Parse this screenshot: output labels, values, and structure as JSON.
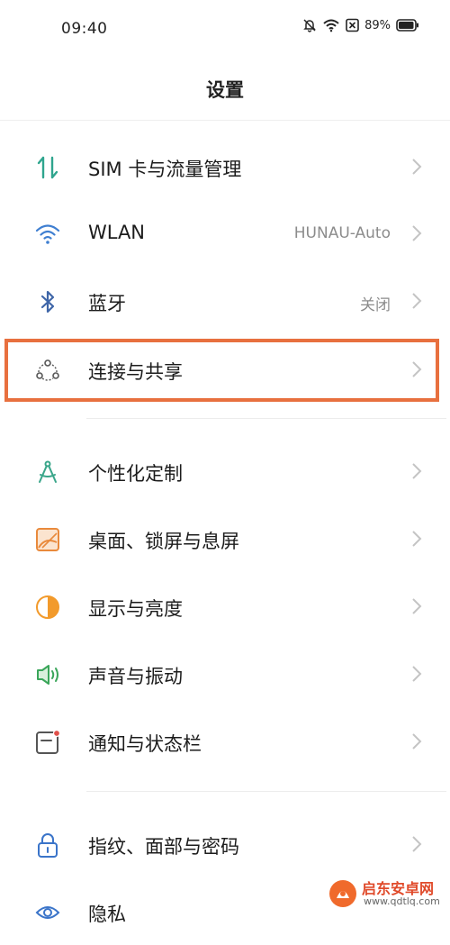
{
  "status": {
    "time": "09:40",
    "battery": "89%"
  },
  "header": {
    "title": "设置"
  },
  "items": [
    {
      "label": "SIM 卡与流量管理",
      "value": ""
    },
    {
      "label": "WLAN",
      "value": "HUNAU-Auto"
    },
    {
      "label": "蓝牙",
      "value": "关闭"
    },
    {
      "label": "连接与共享",
      "value": ""
    },
    {
      "label": "个性化定制",
      "value": ""
    },
    {
      "label": "桌面、锁屏与息屏",
      "value": ""
    },
    {
      "label": "显示与亮度",
      "value": ""
    },
    {
      "label": "声音与振动",
      "value": ""
    },
    {
      "label": "通知与状态栏",
      "value": ""
    },
    {
      "label": "指纹、面部与密码",
      "value": ""
    },
    {
      "label": "隐私",
      "value": ""
    }
  ],
  "watermark": {
    "name": "启东安卓网",
    "url": "www.qdtlq.com"
  },
  "colors": {
    "highlight": "#e8703f",
    "sim_icon_teal": "#2fa58e",
    "wifi_icon_blue": "#3f7fd1",
    "personalize_green": "#3aa68a",
    "desktop_orange": "#e98a3c",
    "display_orange": "#f29a2b",
    "sound_green": "#3aa65a",
    "notify_red": "#e0504a",
    "lock_blue": "#3a74c9"
  }
}
